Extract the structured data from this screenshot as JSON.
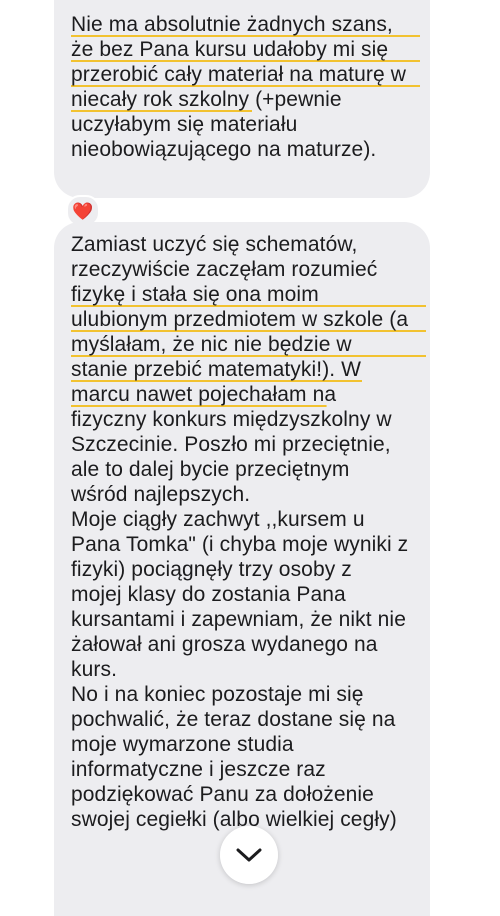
{
  "messages": [
    {
      "lines": [
        "Nie ma absolutnie żadnych szans,",
        "że bez Pana kursu udałoby mi się",
        "przerobić cały materiał na maturę w",
        "niecały rok szkolny (+pewnie",
        "uczyłabym się materiału",
        "nieobowiązującego na maturze)."
      ],
      "reaction": "❤️"
    },
    {
      "lines": [
        "Zamiast uczyć się schematów,",
        "rzeczywiście zaczęłam rozumieć",
        "fizykę i stała się ona moim",
        "ulubionym przedmiotem w szkole (a",
        "myślałam, że nic nie będzie w",
        "stanie przebić matematyki!). W",
        "marcu nawet pojechałam na",
        "fizyczny konkurs międzyszkolny w",
        "Szczecinie. Poszło mi przeciętnie,",
        "ale to dalej bycie przeciętnym",
        "wśród najlepszych.",
        "Moje ciągły zachwyt ,,kursem u",
        "Pana Tomka\" (i chyba moje wyniki z",
        "fizyki) pociągnęły trzy osoby z",
        "mojej klasy do zostania Pana",
        "kursantami i zapewniam, że nikt nie",
        "żałował ani grosza wydanego na",
        "kurs.",
        "No i na koniec pozostaje mi się",
        "pochwalić, że teraz dostane się na",
        "moje wymarzone studia",
        "informatyczne i jeszcze raz",
        "podziękować Panu za dołożenie",
        "swojej  cegiełki (albo wielkiej cegły)"
      ]
    }
  ],
  "scroll_button": {
    "icon": "chevron-down-icon"
  },
  "colors": {
    "bubble": "#ededf0",
    "text": "#1c1c1e",
    "underline": "#f2c230",
    "heart": "#e0263b"
  }
}
